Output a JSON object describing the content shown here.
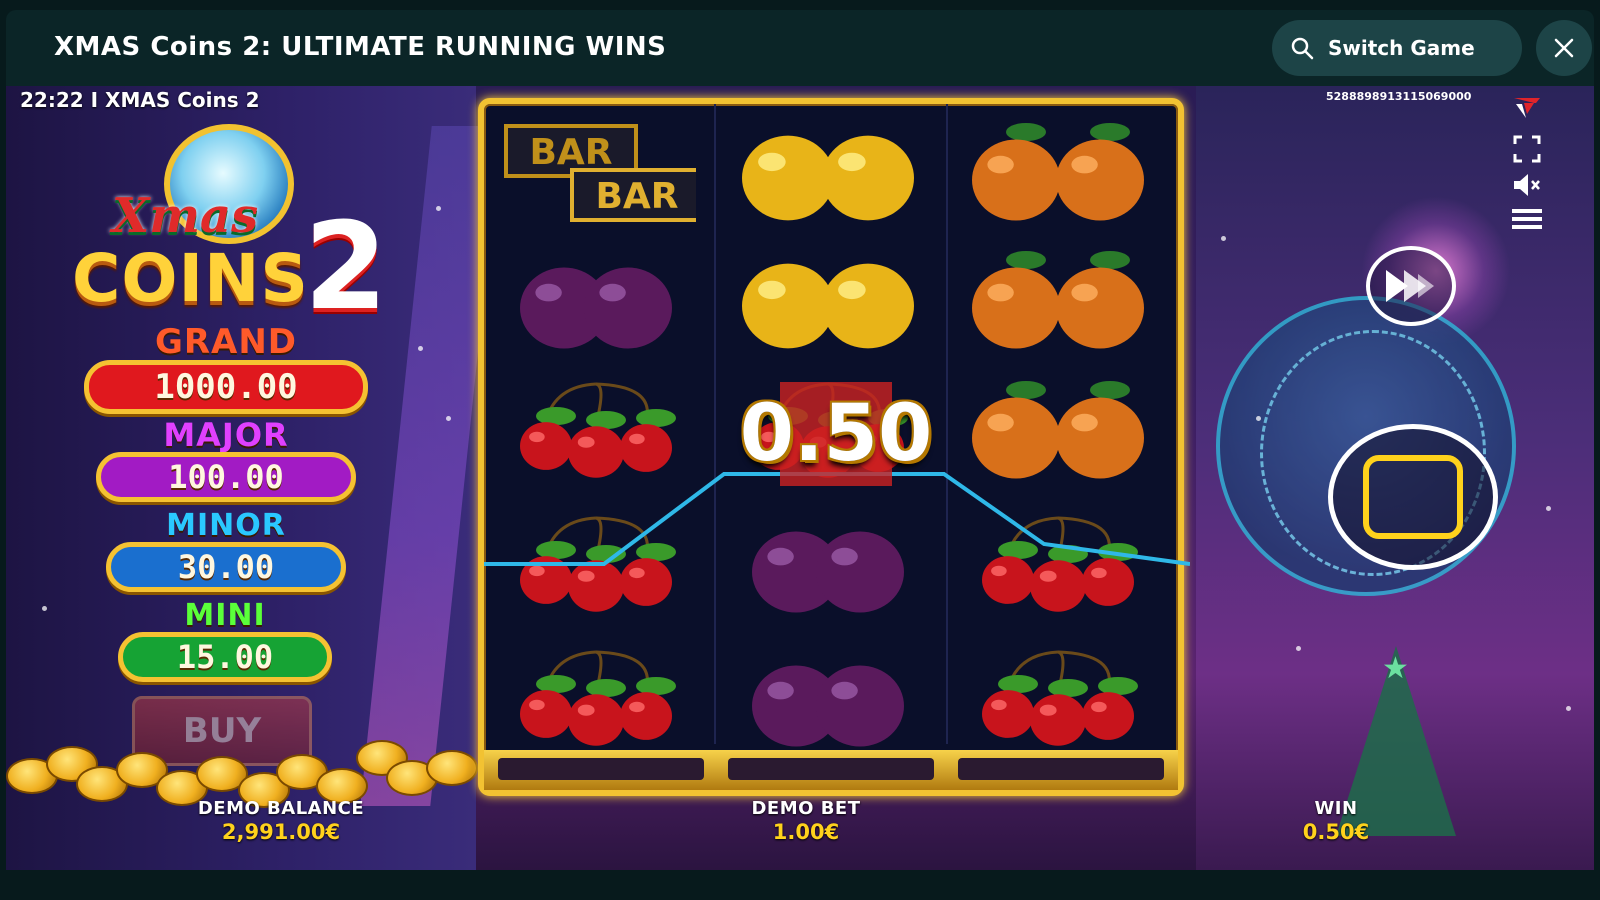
{
  "header": {
    "title": "XMAS Coins 2: ULTIMATE RUNNING WINS",
    "switch_game_label": "Switch Game"
  },
  "game": {
    "clock_line": "22:22 I XMAS Coins 2",
    "game_id": "5288898913115069000",
    "logo": {
      "xmas": "Xmas",
      "coins": "COINS",
      "number": "2"
    },
    "jackpots": [
      {
        "name": "GRAND",
        "value": "1000.00",
        "label_color": "#ff5a2a",
        "box_color": "#e0181e"
      },
      {
        "name": "MAJOR",
        "value": "100.00",
        "label_color": "#e040ff",
        "box_color": "#a21bc4"
      },
      {
        "name": "MINOR",
        "value": "30.00",
        "label_color": "#2ac8ff",
        "box_color": "#1a6fcf"
      },
      {
        "name": "MINI",
        "value": "15.00",
        "label_color": "#5aff3a",
        "box_color": "#16a334"
      }
    ],
    "buy_label": "BUY",
    "win_popup": "0.50",
    "reels": [
      [
        "bar",
        "plum",
        "cherry",
        "cherry",
        "cherry"
      ],
      [
        "lemon",
        "lemon",
        "cherry",
        "plum",
        "plum"
      ],
      [
        "orange",
        "orange",
        "orange",
        "cherry",
        "cherry"
      ]
    ],
    "payline_color": "#2fb8e8",
    "accent_color": "#ffd21c"
  },
  "bottom": {
    "balance_label": "DEMO BALANCE",
    "balance_value": "2,991.00€",
    "bet_label": "DEMO BET",
    "bet_value": "1.00€",
    "win_label": "WIN",
    "win_value": "0.50€"
  },
  "icons": {
    "search": "search-icon",
    "close": "close-icon",
    "fullscreen": "fullscreen-icon",
    "sound": "sound-muted-icon",
    "menu": "menu-icon",
    "turbo": "fast-forward-icon",
    "spin": "spin-icon",
    "brand": "brand-logo-icon"
  }
}
